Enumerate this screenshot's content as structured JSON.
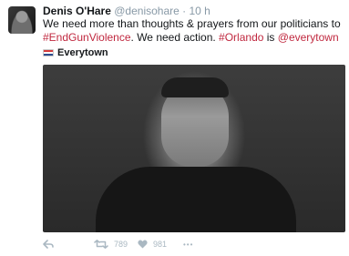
{
  "tweet": {
    "name": "Denis O'Hare",
    "handle": "@denisohare",
    "separator": "·",
    "time": "10 h",
    "text_part1": "We need more than thoughts & prayers from our politicians to ",
    "hashtag_end_gun_violence": "#EndGunViolence",
    "text_part2": ". We need action. ",
    "hashtag_orlando": "#Orlando",
    "text_part3": " is ",
    "mention_everytown": "@everytown"
  },
  "card": {
    "source": "Everytown"
  },
  "actions": {
    "retweets": "789",
    "likes": "981",
    "more": "•••"
  },
  "colors": {
    "highlight": "#c0283f",
    "muted": "#8899a6",
    "icon": "#aab8c2"
  }
}
